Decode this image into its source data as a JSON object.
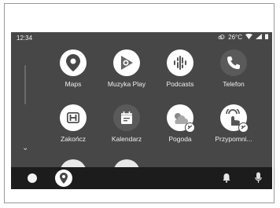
{
  "status": {
    "time": "12:34",
    "temperature": "26°C"
  },
  "apps": [
    {
      "label": "Maps",
      "icon": "maps-pin-icon",
      "bg": "#ffffff"
    },
    {
      "label": "Muzyka Play",
      "icon": "play-music-icon",
      "bg": "#ffffff"
    },
    {
      "label": "Podcasts",
      "icon": "podcasts-icon",
      "bg": "#ffffff"
    },
    {
      "label": "Telefon",
      "icon": "phone-icon",
      "bg": "#5a5a5a"
    },
    {
      "label": "Zakończ",
      "icon": "honda-logo-icon",
      "bg": "#ffffff"
    },
    {
      "label": "Kalendarz",
      "icon": "calendar-icon",
      "bg": "#5a5a5a"
    },
    {
      "label": "Pogoda",
      "icon": "weather-icon",
      "bg": "#ffffff"
    },
    {
      "label": "Przypomni...",
      "icon": "reminder-icon",
      "bg": "#ffffff"
    }
  ],
  "dock": {
    "items": [
      "home-circle-icon",
      "maps-pin-icon",
      "bell-icon",
      "microphone-icon"
    ]
  },
  "colors": {
    "screen_bg": "#474747",
    "dock_bg": "#1c1c1c",
    "text": "#f0f0f0"
  }
}
